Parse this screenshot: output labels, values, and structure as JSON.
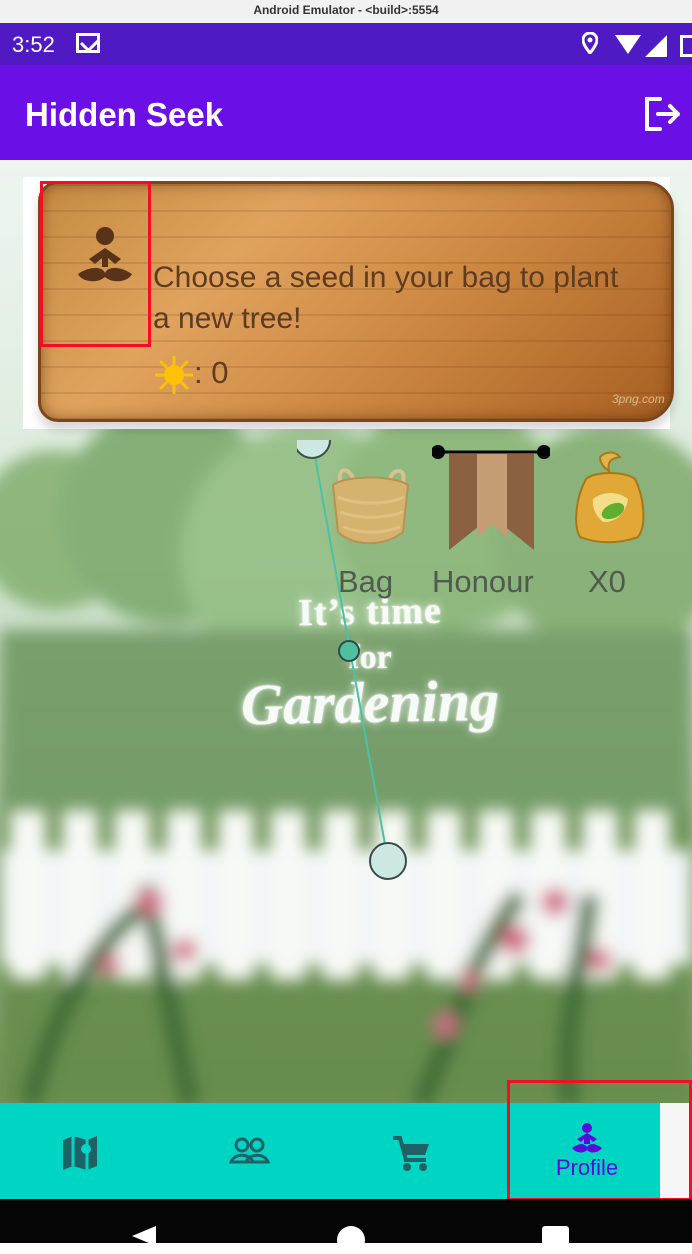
{
  "window": {
    "title": "Android Emulator - <build>:5554"
  },
  "status_bar": {
    "time": "3:52",
    "icons": [
      "mail-icon",
      "location-icon",
      "wifi-icon",
      "signal-icon",
      "battery-icon"
    ]
  },
  "app_bar": {
    "title": "Hidden Seek",
    "action_icon": "logout-icon"
  },
  "signboard": {
    "icon": "meditation-person-icon",
    "message": "Choose a seed in your bag to plant a new tree!",
    "sun_count": ": 0",
    "watermark": "3png.com"
  },
  "actions": [
    {
      "label": "Bag",
      "icon": "bag-icon"
    },
    {
      "label": "Honour",
      "icon": "honour-banner-icon"
    },
    {
      "label": "X0",
      "icon": "seed-bag-icon"
    }
  ],
  "background_text": {
    "line1": "It’s time",
    "line2": "for",
    "line3": "Gardening"
  },
  "bottom_navigation": {
    "items": [
      {
        "name": "map",
        "icon": "map-icon",
        "label": ""
      },
      {
        "name": "friends",
        "icon": "group-icon",
        "label": ""
      },
      {
        "name": "shop",
        "icon": "cart-icon",
        "label": ""
      },
      {
        "name": "profile",
        "icon": "meditation-person-icon",
        "label": "Profile",
        "selected": true
      }
    ]
  },
  "colors": {
    "app_bar": "#6a10e6",
    "status_bar": "#4f1ac4",
    "bottom_navigation": "#00d4c3",
    "selected_navigation": "#5a0bd7",
    "highlight": "#f60d23",
    "sign_text": "#5e3b21"
  }
}
